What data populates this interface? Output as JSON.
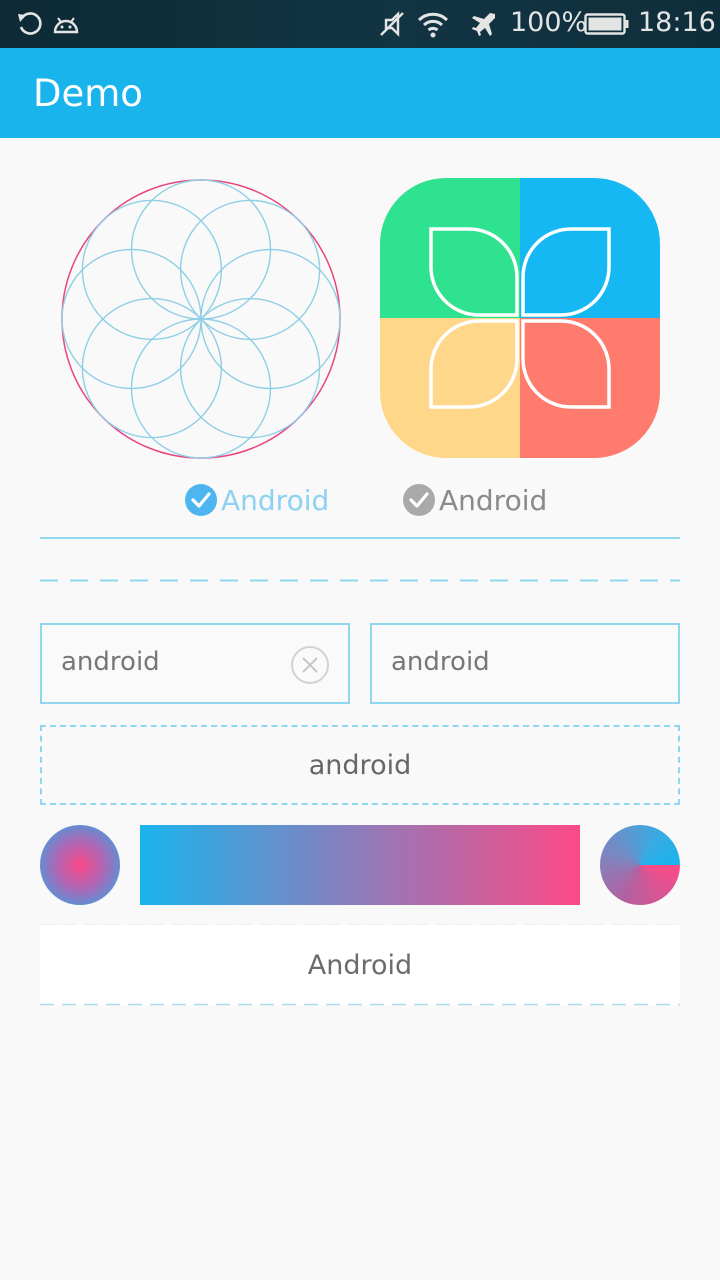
{
  "status_bar": {
    "battery": "100%",
    "time": "18:16",
    "icons": [
      "refresh-icon",
      "android-icon",
      "mute-icon",
      "wifi-icon",
      "airplane-icon",
      "battery-icon"
    ]
  },
  "app_bar": {
    "title": "Demo"
  },
  "checkboxes": [
    {
      "label": "Android",
      "checked": true,
      "color": "#4db6f0"
    },
    {
      "label": "Android",
      "checked": true,
      "color": "#a9a9a9"
    }
  ],
  "inputs": [
    {
      "value": "android",
      "has_clear": true
    },
    {
      "value": "android"
    }
  ],
  "dashed_button": {
    "label": "android"
  },
  "white_button": {
    "label": "Android"
  },
  "gradient": {
    "start": "#1ab4ed",
    "end": "#fc4a87"
  },
  "accent_colors": {
    "green": "#2ee28f",
    "blue": "#16b8f4",
    "yellow": "#ffd78a",
    "red": "#ff7b6e",
    "line": "#8fd6ef"
  }
}
